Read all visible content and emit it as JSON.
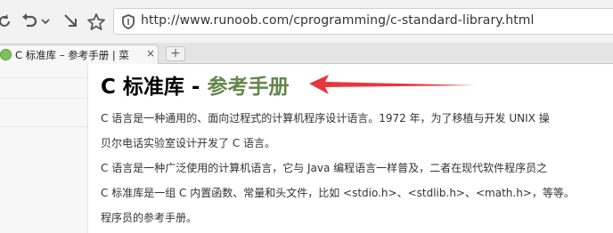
{
  "browser": {
    "url_text": "http://www.runoob.com/cprogramming/c-standard-library.html",
    "icons": [
      "reload-icon",
      "back-icon",
      "chevron-down-icon",
      "bookmark-star-icon",
      "shield-icon"
    ]
  },
  "tabs": [
    {
      "title": "C 标准库 – 参考手册 | 菜",
      "close": "×"
    }
  ],
  "newtab_label": "+",
  "page": {
    "title_prefix": "C 标准库 - ",
    "title_accent": "参考手册",
    "accent_color": "#64854c",
    "arrow_color": "#e8363a",
    "paragraphs": [
      "C 语言是一种通用的、面向过程式的计算机程序设计语言。1972 年，为了移植与开发 UNIX 操",
      "贝尔电话实验室设计开发了 C 语言。",
      "C 语言是一种广泛使用的计算机语言，它与 Java 编程语言一样普及，二者在现代软件程序员之",
      "C 标准库是一组 C 内置函数、常量和头文件，比如 <stdio.h>、<stdlib.h>、<math.h>，等等。",
      "程序员的参考手册。"
    ]
  }
}
